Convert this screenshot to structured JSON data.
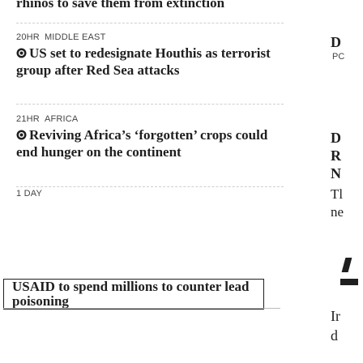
{
  "top_story": {
    "title": "rhinos to save them from extinction"
  },
  "stories": [
    {
      "time": "20HR",
      "region": "MIDDLE EAST",
      "headline": "US set to redesignate Houthis as terrorist group after Red Sea attacks",
      "icon": "live-dot-icon"
    },
    {
      "time": "21HR",
      "region": "AFRICA",
      "headline": "Reviving Africa’s ‘forgotten’ crops could end hunger on the continent",
      "icon": "live-dot-icon"
    },
    {
      "time": "1 DAY",
      "region": "",
      "headline_line1": "USAID to spend millions to counter lead",
      "headline_line2": "poisoning"
    }
  ],
  "right_strip": {
    "letters": [
      "D",
      "PC",
      "D",
      "R",
      "N",
      "Tl",
      "ne",
      "Ir",
      "d"
    ]
  },
  "colors": {
    "text": "#1f1f1f",
    "meta": "#444444",
    "divider": "#cfcfcf"
  }
}
